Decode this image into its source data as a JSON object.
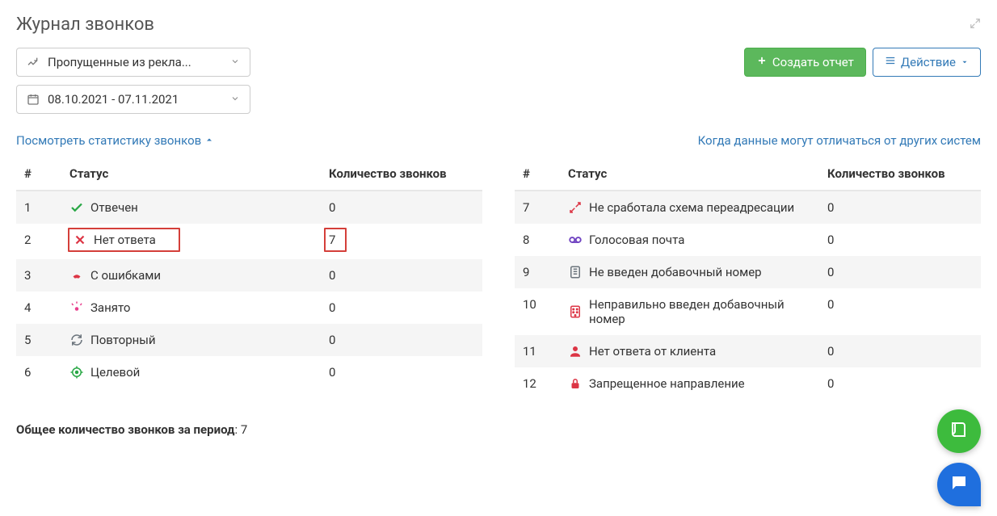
{
  "header": {
    "title": "Журнал звонков"
  },
  "toolbar": {
    "report_select": "Пропущенные из рекла...",
    "date_range": "08.10.2021 - 07.11.2021",
    "create_report": "Создать отчет",
    "action": "Действие"
  },
  "links": {
    "stats": "Посмотреть статистику звонков",
    "differ": "Когда данные могут отличаться от других систем"
  },
  "columns": {
    "index": "#",
    "status": "Статус",
    "count": "Количество звонков"
  },
  "left": [
    {
      "n": "1",
      "label": "Отвечен",
      "count": "0",
      "icon": "check",
      "color": "#28a745",
      "hl": false
    },
    {
      "n": "2",
      "label": "Нет ответа",
      "count": "7",
      "icon": "cross",
      "color": "#dc3545",
      "hl": true
    },
    {
      "n": "3",
      "label": "С ошибками",
      "count": "0",
      "icon": "phone-drop",
      "color": "#dc3545",
      "hl": false
    },
    {
      "n": "4",
      "label": "Занято",
      "count": "0",
      "icon": "busy",
      "color": "#e83e8c",
      "hl": false
    },
    {
      "n": "5",
      "label": "Повторный",
      "count": "0",
      "icon": "repeat",
      "color": "#6c757d",
      "hl": false
    },
    {
      "n": "6",
      "label": "Целевой",
      "count": "0",
      "icon": "target",
      "color": "#28a745",
      "hl": false
    }
  ],
  "right": [
    {
      "n": "7",
      "label": "Не сработала схема переадресации",
      "count": "0",
      "icon": "arrows-split",
      "color": "#dc3545",
      "hl": false
    },
    {
      "n": "8",
      "label": "Голосовая почта",
      "count": "0",
      "icon": "voicemail",
      "color": "#6f42c1",
      "hl": false
    },
    {
      "n": "9",
      "label": "Не введен добавочный номер",
      "count": "0",
      "icon": "keypad-x",
      "color": "#6c757d",
      "hl": false
    },
    {
      "n": "10",
      "label": "Неправильно введен добавочный номер",
      "count": "0",
      "icon": "keypad-bad",
      "color": "#dc3545",
      "hl": false
    },
    {
      "n": "11",
      "label": "Нет ответа от клиента",
      "count": "0",
      "icon": "client-mute",
      "color": "#dc3545",
      "hl": false
    },
    {
      "n": "12",
      "label": "Запрещенное направление",
      "count": "0",
      "icon": "lock",
      "color": "#dc3545",
      "hl": false
    }
  ],
  "footer": {
    "label": "Общее количество звонков за период",
    "value": "7"
  }
}
